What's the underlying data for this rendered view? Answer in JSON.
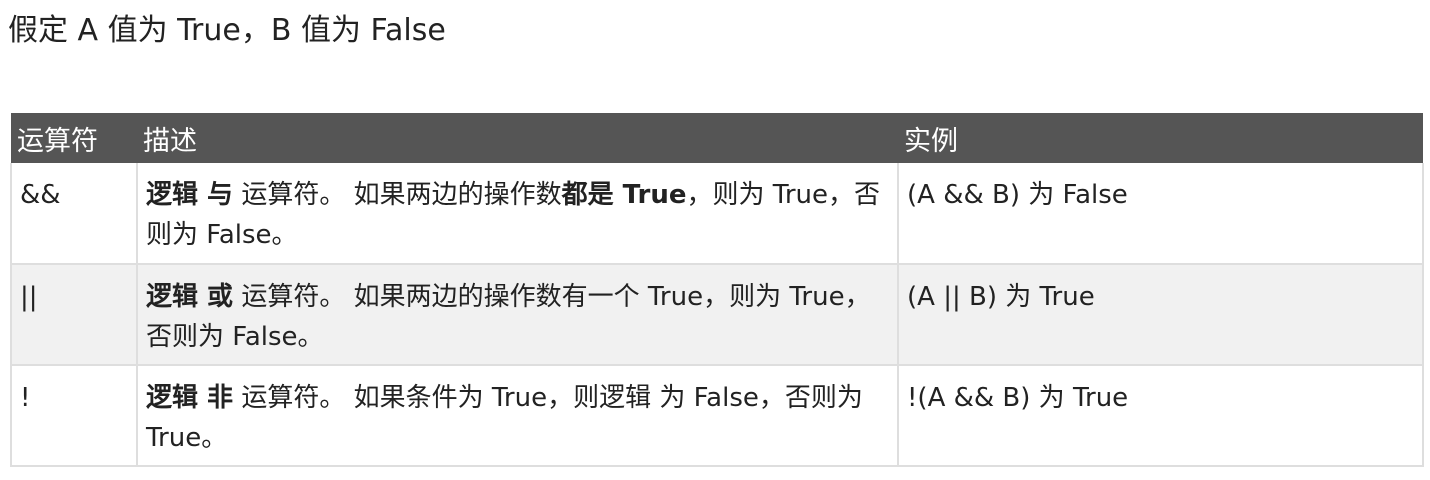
{
  "intro": "假定 A 值为 True，B 值为 False",
  "table": {
    "headers": {
      "operator": "运算符",
      "description": "描述",
      "example": "实例"
    },
    "rows": [
      {
        "operator": "&&",
        "desc_bold": "逻辑 与",
        "desc_text1": " 运算符。 如果两边的操作数",
        "desc_bold2": "都是 True",
        "desc_text2": "，则为 True，否则为 False。",
        "example": "(A && B) 为 False"
      },
      {
        "operator": "||",
        "desc_bold": "逻辑 或",
        "desc_text1": " 运算符。 如果两边的操作数有一个 True，则为 True，否则为 False。",
        "example": "(A || B) 为 True"
      },
      {
        "operator": "!",
        "desc_bold": "逻辑 非",
        "desc_text1": " 运算符。 如果条件为 True，则逻辑 为 False，否则为 True。",
        "example": "!(A && B) 为 True"
      }
    ]
  }
}
